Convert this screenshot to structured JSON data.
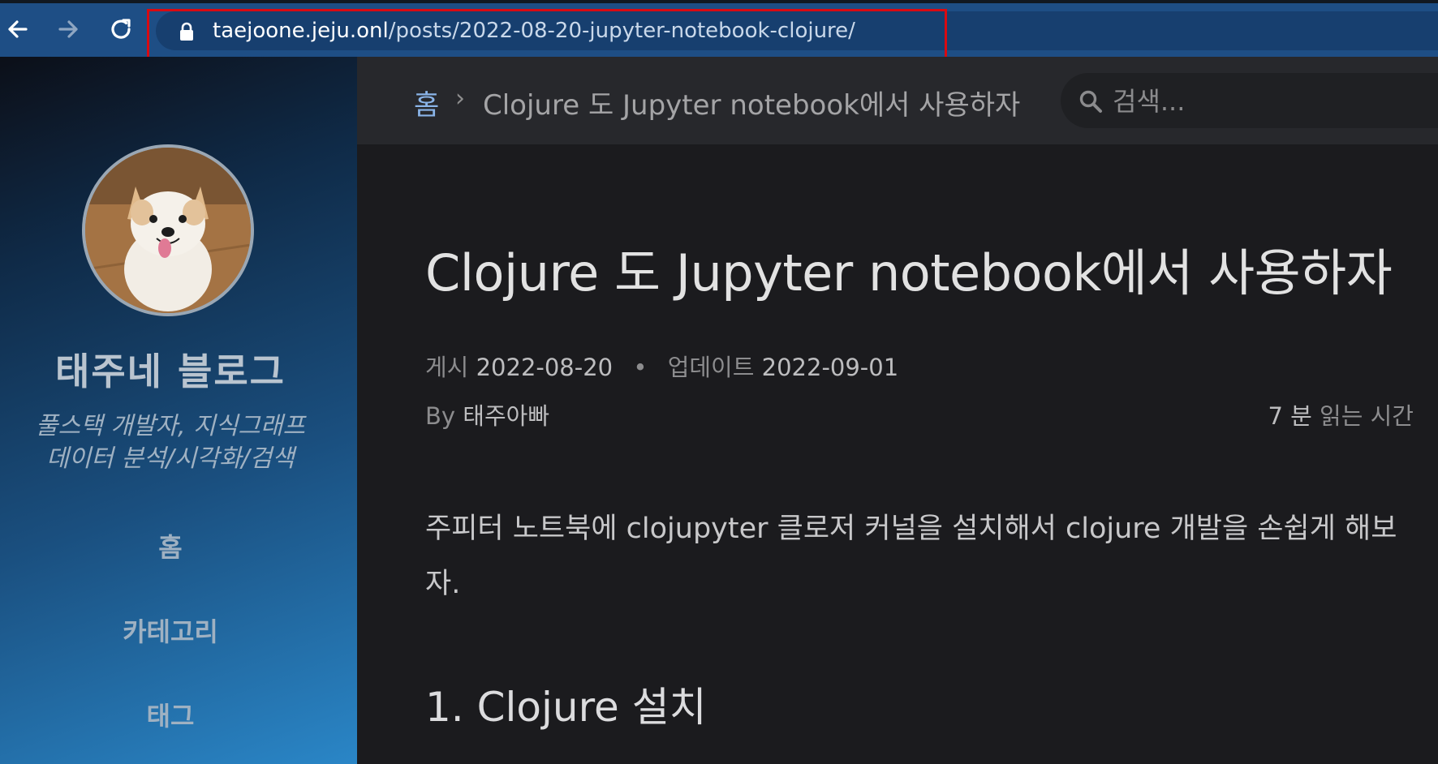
{
  "browser": {
    "url_host": "taejoone.jeju.onl",
    "url_path": "/posts/2022-08-20-jupyter-notebook-clojure/",
    "highlight_color": "#d90a12"
  },
  "sidebar": {
    "site_title": "태주네 블로그",
    "subtitle_line1": "풀스택 개발자, 지식그래프",
    "subtitle_line2": "데이터 분석/시각화/검색",
    "nav": [
      {
        "label": "홈"
      },
      {
        "label": "카테고리"
      },
      {
        "label": "태그"
      }
    ]
  },
  "topbar": {
    "breadcrumb_home": "홈",
    "breadcrumb_separator": "›",
    "breadcrumb_current": "Clojure 도 Jupyter notebook에서 사용하자",
    "search_placeholder": "검색..."
  },
  "post": {
    "title": "Clojure 도 Jupyter notebook에서 사용하자",
    "posted_label": "게시",
    "posted_date": "2022-08-20",
    "updated_label": "업데이트",
    "updated_date": "2022-09-01",
    "by_label": "By",
    "author": "태주아빠",
    "read_minutes": "7 분",
    "read_label": "읽는 시간",
    "intro": "주피터 노트북에 clojupyter 클로저 커널을 설치해서 clojure 개발을 손쉽게 해보자.",
    "section_heading": "1. Clojure 설치"
  },
  "colors": {
    "browser_bar": "#1e4e85",
    "content_bg": "#1b1b1e",
    "topbar_bg": "#27282c",
    "link": "#8ab4e8"
  },
  "icons": [
    "back-arrow-icon",
    "forward-arrow-icon",
    "reload-icon",
    "lock-icon",
    "search-icon",
    "avatar-dog-photo"
  ]
}
